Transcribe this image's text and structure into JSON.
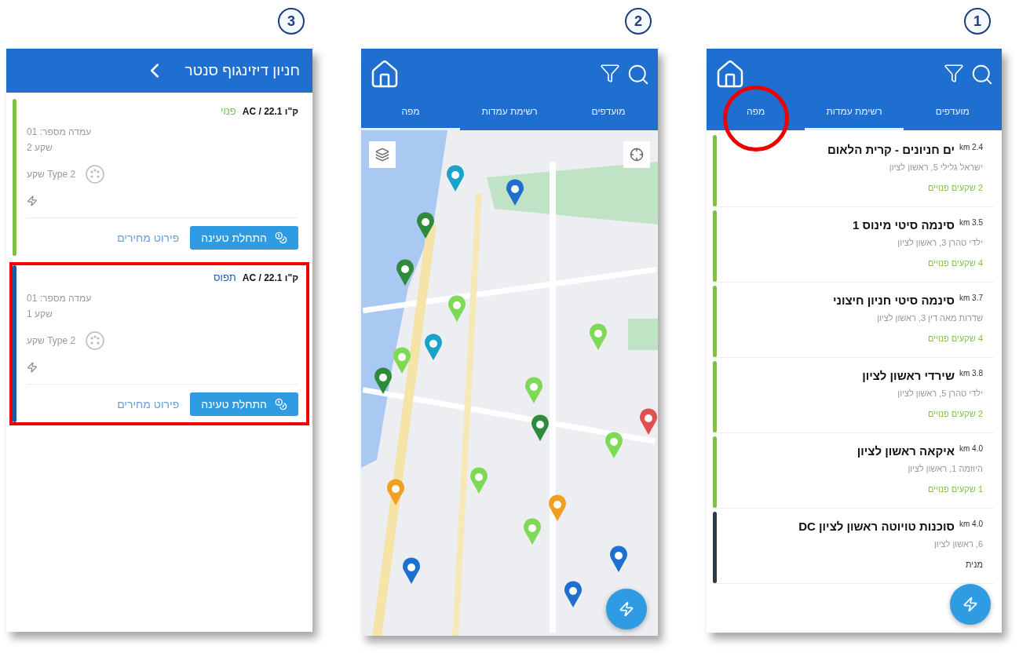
{
  "screens": [
    {
      "kind": "list",
      "step": "1",
      "tabs": [
        {
          "label": "מועדפים",
          "selected": false,
          "circled": false
        },
        {
          "label": "רשימת עמדות",
          "selected": true,
          "circled": false
        },
        {
          "label": "מפה",
          "selected": false,
          "circled": true
        }
      ],
      "stations": [
        {
          "name": "ים חניונים - קרית הלאום",
          "distance": "2.4 km",
          "address": "ישראל גלילי 5, ראשון לציון",
          "status": "2 שקעים פנויים",
          "color": "#7cc04b"
        },
        {
          "name": "סינמה סיטי מינוס 1",
          "distance": "3.5 km",
          "address": "ילדי טהרן 3, ראשון לציון",
          "status": "4 שקעים פנויים",
          "color": "#7cc04b"
        },
        {
          "name": "סינמה סיטי חניון חיצוני",
          "distance": "3.7 km",
          "address": "שדרות מאה דין 3, ראשון לציון",
          "status": "4 שקעים פנויים",
          "color": "#7cc04b"
        },
        {
          "name": "שירדי ראשון לציון",
          "distance": "3.8 km",
          "address": "ילדי טהרן 5, ראשון לציון",
          "status": "2 שקעים פנויים",
          "color": "#7cc04b"
        },
        {
          "name": "איקאה ראשון לציון",
          "distance": "4.0 km",
          "address": "היוזמה 1, ראשון לציון",
          "status": "1 שקעים פנויים",
          "color": "#7cc04b"
        },
        {
          "name": "סוכנות טויוטה ראשון לציון DC",
          "distance": "4.0 km",
          "address": "6, ראשון לציון",
          "status": "מנית",
          "color": "#2d3a4a"
        }
      ]
    },
    {
      "kind": "map",
      "step": "2",
      "tabs": [
        {
          "label": "מועדפים",
          "selected": false,
          "circled": false
        },
        {
          "label": "רשימת עמדות",
          "selected": false,
          "circled": false
        },
        {
          "label": "מפה",
          "selected": true,
          "circled": false
        }
      ]
    },
    {
      "kind": "detail",
      "step": "3",
      "title": "חניון דיזינגוף סנטר",
      "connectors": [
        {
          "power": "ק\"ו AC / 22.1",
          "status": "פנוי",
          "color": "#7cc04b",
          "station": "עמדה מספר: 01",
          "socket": "שקע 2",
          "socket_type": "שקע Type 2",
          "start_button": "התחלת טעינה",
          "prices_link": "פירוט מחירים",
          "highlighted": false
        },
        {
          "power": "ק\"ו AC / 22.1",
          "status": "תפוס",
          "color": "#1f5aa6",
          "station": "עמדה מספר: 01",
          "socket": "שקע 1",
          "socket_type": "שקע Type 2",
          "start_button": "התחלת טעינה",
          "prices_link": "פירוט מחירים",
          "highlighted": true
        }
      ]
    }
  ]
}
